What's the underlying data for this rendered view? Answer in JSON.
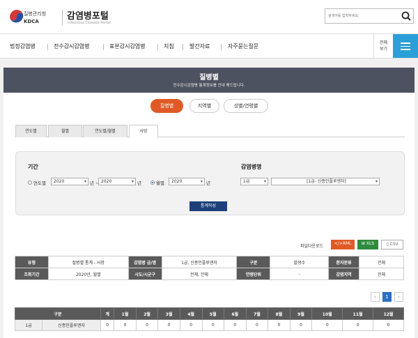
{
  "header": {
    "agency_ko": "질병관리청",
    "agency_en": "KDCA",
    "portal_title": "감염병포털",
    "portal_sub": "Infectious Disease Portal",
    "search_placeholder": "검색어를 입력하세요."
  },
  "nav": {
    "items": [
      "법정감염병",
      "전수감시감염병",
      "표본감시감염병",
      "지침",
      "발간자료",
      "자주묻는질문"
    ],
    "all_view": "전체\n보기"
  },
  "banner": {
    "title": "질병별",
    "subtitle": "전수감시감염병 통계정보를 안내 해드립니다."
  },
  "view_tabs": [
    "질병별",
    "지역별",
    "성별/연령별"
  ],
  "sub_tabs": [
    "연도별",
    "월별",
    "연도별/월별",
    "사망"
  ],
  "filter": {
    "period_title": "기간",
    "yearly_label": "연도별",
    "year_from": "2020",
    "year_sep": "년 ~",
    "year_to": "2020",
    "year_unit": "년",
    "monthly_label": "월별",
    "month_year": "2020",
    "month_unit": "년",
    "disease_title": "감염병명",
    "grade": "1급",
    "disease": "[1급- 신종인플루엔자]",
    "submit": "통계작성"
  },
  "download": {
    "label": "파일다운로드",
    "xml": "XML",
    "xls": "XLS",
    "csv": "CSV"
  },
  "info": {
    "r1": [
      "유형",
      "질병별 통계 - 사망",
      "감염병 급/명",
      "1급, 신종인플루엔자",
      "구분",
      "발생수",
      "환자분류",
      "전체"
    ],
    "r2": [
      "조회기간",
      "2020년, 월별",
      "시도/시군구",
      "전체, 전체",
      "연령단위",
      "-",
      "감염지역",
      "전체"
    ]
  },
  "pager": {
    "prev": "‹",
    "current": "1",
    "next": "›"
  },
  "grid": {
    "headers": [
      "구분",
      "계",
      "1월",
      "2월",
      "3월",
      "4월",
      "5월",
      "6월",
      "7월",
      "8월",
      "9월",
      "10월",
      "11월",
      "12월"
    ],
    "row": {
      "grade": "1급",
      "name": "신종인플루엔자",
      "values": [
        "0",
        "0",
        "0",
        "0",
        "0",
        "0",
        "0",
        "0",
        "0",
        "0",
        "0",
        "0",
        "0"
      ]
    }
  },
  "colors": {
    "accent": "#e05a26",
    "navy": "#1d3f7a",
    "banner": "#4d5260",
    "menu": "#2a9fd8"
  }
}
